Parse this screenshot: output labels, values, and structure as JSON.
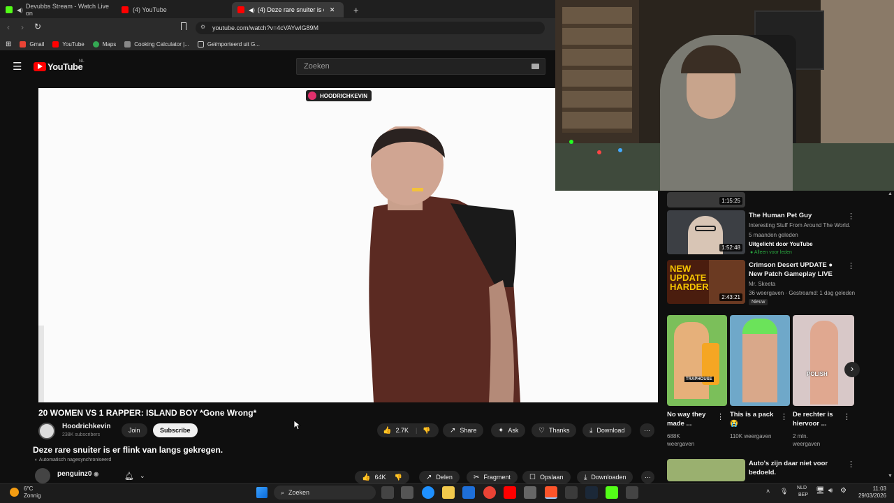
{
  "tabs": [
    {
      "label": "Devubbs Stream - Watch Live on"
    },
    {
      "label": "(4) YouTube"
    },
    {
      "label": "(4) Deze rare snuiter is er flink"
    }
  ],
  "url": "youtube.com/watch?v=4cVAYwIG89M",
  "bookmarks": [
    "Gmail",
    "YouTube",
    "Maps",
    "Cooking Calculator |...",
    "Geïmporteerd uit G..."
  ],
  "yt": {
    "logo": "YouTube",
    "region": "NL",
    "search_placeholder": "Zoeken"
  },
  "player": {
    "watermark": "HOODRICHKEVIN"
  },
  "video": {
    "title": "20 WOMEN VS 1 RAPPER: ISLAND BOY *Gone Wrong*",
    "channel": "Hoodrichkevin",
    "subscribers": "238K subscribers",
    "join": "Join",
    "subscribe": "Subscribe",
    "likes": "2.7K",
    "share": "Share",
    "ask": "Ask",
    "thanks": "Thanks",
    "download": "Download"
  },
  "outer_video": {
    "title": "Deze rare snuiter is er flink van langs gekregen.",
    "dubbed": "Automatisch nagesynchroniseerd",
    "channel": "penguinz0",
    "likes": "64K",
    "share": "Delen",
    "clip": "Fragment",
    "save": "Opslaan",
    "download": "Downloaden"
  },
  "sidebar": {
    "top_duration": "1:15:25",
    "items": [
      {
        "title": "The Human Pet Guy",
        "channel": "Interesting Stuff From Around The World.",
        "meta": "5 maanden geleden",
        "badge": "Uitgelicht door YouTube",
        "extra": "Alleen voor leden",
        "duration": "1:52:48"
      },
      {
        "title": "Crimson Desert UPDATE ● New Patch Gameplay LIVE",
        "channel": "Mr. Skeeta",
        "meta": "36 weergaven · Gestreamd: 1 dag geleden",
        "badge": "Nieuw",
        "duration": "2:43:21",
        "thumb_text": "NEW UPDATE HARDER??"
      }
    ],
    "shorts": [
      {
        "title": "No way they made ...",
        "views": "688K weergaven",
        "tag": "TRAPHOUSE"
      },
      {
        "title": "This is a pack 😭",
        "views": "110K weergaven",
        "tag": ""
      },
      {
        "title": "De rechter is hiervoor ...",
        "views": "2 mln. weergaven",
        "tag": "POLISH"
      }
    ],
    "last": {
      "title": "Auto's zijn daar niet voor bedoeld."
    }
  },
  "taskbar": {
    "weather_temp": "6°C",
    "weather_desc": "Zonnig",
    "search": "Zoeken",
    "lang": "NLD",
    "lang2": "BEP",
    "time": "11:03",
    "date": "29/03/2026"
  },
  "colors": {
    "yt_red": "#ff0000",
    "bg": "#0f0f0f",
    "pill": "#272727"
  }
}
